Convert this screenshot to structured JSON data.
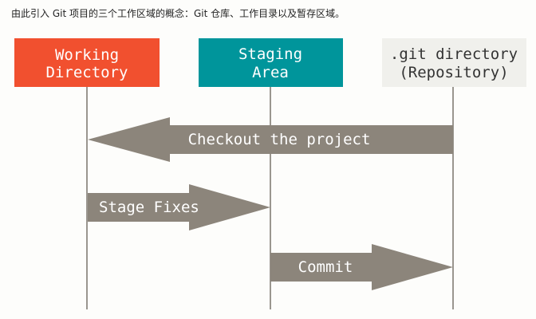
{
  "intro": {
    "text": "由此引入 Git 项目的三个工作区域的概念：Git 仓库、工作目录以及暂存区域。"
  },
  "areas": [
    {
      "id": "working",
      "lines": [
        "Working",
        "Directory"
      ],
      "fill": "#f1502f",
      "text_color": "#ffffff"
    },
    {
      "id": "staging",
      "lines": [
        "Staging",
        "Area"
      ],
      "fill": "#00959b",
      "text_color": "#ffffff"
    },
    {
      "id": "repository",
      "lines": [
        ".git directory",
        "(Repository)"
      ],
      "fill": "#f0f0ec",
      "text_color": "#333333"
    }
  ],
  "arrows": [
    {
      "id": "checkout",
      "label": "Checkout the project",
      "from": "repository",
      "to": "working"
    },
    {
      "id": "stage-fixes",
      "label": "Stage Fixes",
      "from": "working",
      "to": "staging"
    },
    {
      "id": "commit",
      "label": "Commit",
      "from": "staging",
      "to": "repository"
    }
  ],
  "colors": {
    "arrow": "#8c857b",
    "lifeline": "#9a968f"
  }
}
